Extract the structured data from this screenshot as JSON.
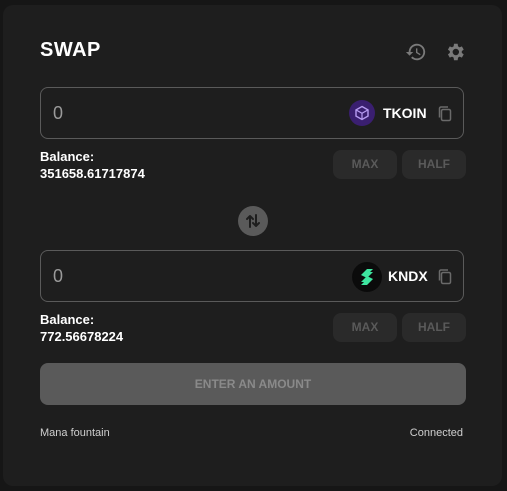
{
  "header": {
    "title": "SWAP",
    "history_icon": "history-icon",
    "settings_icon": "gear-icon"
  },
  "from": {
    "amount_placeholder": "0",
    "token": "TKOIN",
    "token_icon": "tkoin-logo-icon",
    "balance_label": "Balance:",
    "balance_value": "351658.61717874",
    "max_label": "MAX",
    "half_label": "HALF"
  },
  "swap_icon": "swap-arrows-icon",
  "to": {
    "amount_placeholder": "0",
    "token": "KNDX",
    "token_icon": "kndx-logo-icon",
    "balance_label": "Balance:",
    "balance_value": "772.56678224",
    "max_label": "MAX",
    "half_label": "HALF"
  },
  "action": {
    "label": "ENTER AN AMOUNT"
  },
  "footer": {
    "left": "Mana fountain",
    "right": "Connected"
  },
  "colors": {
    "panel_bg": "#1e1e1e",
    "page_bg": "#161616",
    "border": "#5a5a5a",
    "tkoin_purple": "#4b2a8a",
    "kndx_green": "#3ee6a0"
  }
}
